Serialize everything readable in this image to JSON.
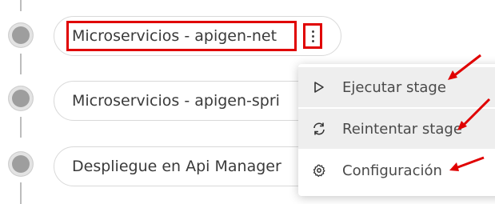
{
  "stages": [
    {
      "label": "Microservicios - apigen-net"
    },
    {
      "label": "Microservicios - apigen-spri"
    },
    {
      "label": "Despliegue en Api Manager"
    }
  ],
  "context_menu": {
    "items": [
      {
        "icon": "play-icon",
        "label": "Ejecutar stage"
      },
      {
        "icon": "retry-icon",
        "label": "Reintentar stage"
      },
      {
        "icon": "gear-icon",
        "label": "Configuración"
      }
    ]
  },
  "colors": {
    "annotation": "#e00000",
    "menu_hover": "#eeeeee",
    "status_dot": "#9e9e9e"
  }
}
